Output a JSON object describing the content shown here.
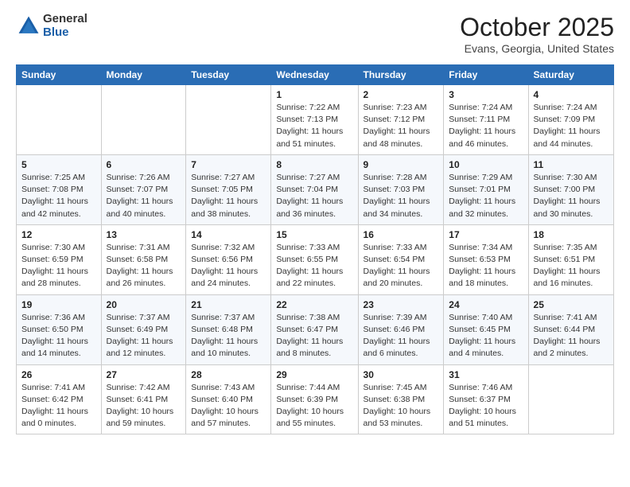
{
  "header": {
    "logo_general": "General",
    "logo_blue": "Blue",
    "month_title": "October 2025",
    "location": "Evans, Georgia, United States"
  },
  "columns": [
    "Sunday",
    "Monday",
    "Tuesday",
    "Wednesday",
    "Thursday",
    "Friday",
    "Saturday"
  ],
  "weeks": [
    [
      {
        "day": "",
        "info": ""
      },
      {
        "day": "",
        "info": ""
      },
      {
        "day": "",
        "info": ""
      },
      {
        "day": "1",
        "info": "Sunrise: 7:22 AM\nSunset: 7:13 PM\nDaylight: 11 hours and 51 minutes."
      },
      {
        "day": "2",
        "info": "Sunrise: 7:23 AM\nSunset: 7:12 PM\nDaylight: 11 hours and 48 minutes."
      },
      {
        "day": "3",
        "info": "Sunrise: 7:24 AM\nSunset: 7:11 PM\nDaylight: 11 hours and 46 minutes."
      },
      {
        "day": "4",
        "info": "Sunrise: 7:24 AM\nSunset: 7:09 PM\nDaylight: 11 hours and 44 minutes."
      }
    ],
    [
      {
        "day": "5",
        "info": "Sunrise: 7:25 AM\nSunset: 7:08 PM\nDaylight: 11 hours and 42 minutes."
      },
      {
        "day": "6",
        "info": "Sunrise: 7:26 AM\nSunset: 7:07 PM\nDaylight: 11 hours and 40 minutes."
      },
      {
        "day": "7",
        "info": "Sunrise: 7:27 AM\nSunset: 7:05 PM\nDaylight: 11 hours and 38 minutes."
      },
      {
        "day": "8",
        "info": "Sunrise: 7:27 AM\nSunset: 7:04 PM\nDaylight: 11 hours and 36 minutes."
      },
      {
        "day": "9",
        "info": "Sunrise: 7:28 AM\nSunset: 7:03 PM\nDaylight: 11 hours and 34 minutes."
      },
      {
        "day": "10",
        "info": "Sunrise: 7:29 AM\nSunset: 7:01 PM\nDaylight: 11 hours and 32 minutes."
      },
      {
        "day": "11",
        "info": "Sunrise: 7:30 AM\nSunset: 7:00 PM\nDaylight: 11 hours and 30 minutes."
      }
    ],
    [
      {
        "day": "12",
        "info": "Sunrise: 7:30 AM\nSunset: 6:59 PM\nDaylight: 11 hours and 28 minutes."
      },
      {
        "day": "13",
        "info": "Sunrise: 7:31 AM\nSunset: 6:58 PM\nDaylight: 11 hours and 26 minutes."
      },
      {
        "day": "14",
        "info": "Sunrise: 7:32 AM\nSunset: 6:56 PM\nDaylight: 11 hours and 24 minutes."
      },
      {
        "day": "15",
        "info": "Sunrise: 7:33 AM\nSunset: 6:55 PM\nDaylight: 11 hours and 22 minutes."
      },
      {
        "day": "16",
        "info": "Sunrise: 7:33 AM\nSunset: 6:54 PM\nDaylight: 11 hours and 20 minutes."
      },
      {
        "day": "17",
        "info": "Sunrise: 7:34 AM\nSunset: 6:53 PM\nDaylight: 11 hours and 18 minutes."
      },
      {
        "day": "18",
        "info": "Sunrise: 7:35 AM\nSunset: 6:51 PM\nDaylight: 11 hours and 16 minutes."
      }
    ],
    [
      {
        "day": "19",
        "info": "Sunrise: 7:36 AM\nSunset: 6:50 PM\nDaylight: 11 hours and 14 minutes."
      },
      {
        "day": "20",
        "info": "Sunrise: 7:37 AM\nSunset: 6:49 PM\nDaylight: 11 hours and 12 minutes."
      },
      {
        "day": "21",
        "info": "Sunrise: 7:37 AM\nSunset: 6:48 PM\nDaylight: 11 hours and 10 minutes."
      },
      {
        "day": "22",
        "info": "Sunrise: 7:38 AM\nSunset: 6:47 PM\nDaylight: 11 hours and 8 minutes."
      },
      {
        "day": "23",
        "info": "Sunrise: 7:39 AM\nSunset: 6:46 PM\nDaylight: 11 hours and 6 minutes."
      },
      {
        "day": "24",
        "info": "Sunrise: 7:40 AM\nSunset: 6:45 PM\nDaylight: 11 hours and 4 minutes."
      },
      {
        "day": "25",
        "info": "Sunrise: 7:41 AM\nSunset: 6:44 PM\nDaylight: 11 hours and 2 minutes."
      }
    ],
    [
      {
        "day": "26",
        "info": "Sunrise: 7:41 AM\nSunset: 6:42 PM\nDaylight: 11 hours and 0 minutes."
      },
      {
        "day": "27",
        "info": "Sunrise: 7:42 AM\nSunset: 6:41 PM\nDaylight: 10 hours and 59 minutes."
      },
      {
        "day": "28",
        "info": "Sunrise: 7:43 AM\nSunset: 6:40 PM\nDaylight: 10 hours and 57 minutes."
      },
      {
        "day": "29",
        "info": "Sunrise: 7:44 AM\nSunset: 6:39 PM\nDaylight: 10 hours and 55 minutes."
      },
      {
        "day": "30",
        "info": "Sunrise: 7:45 AM\nSunset: 6:38 PM\nDaylight: 10 hours and 53 minutes."
      },
      {
        "day": "31",
        "info": "Sunrise: 7:46 AM\nSunset: 6:37 PM\nDaylight: 10 hours and 51 minutes."
      },
      {
        "day": "",
        "info": ""
      }
    ]
  ]
}
